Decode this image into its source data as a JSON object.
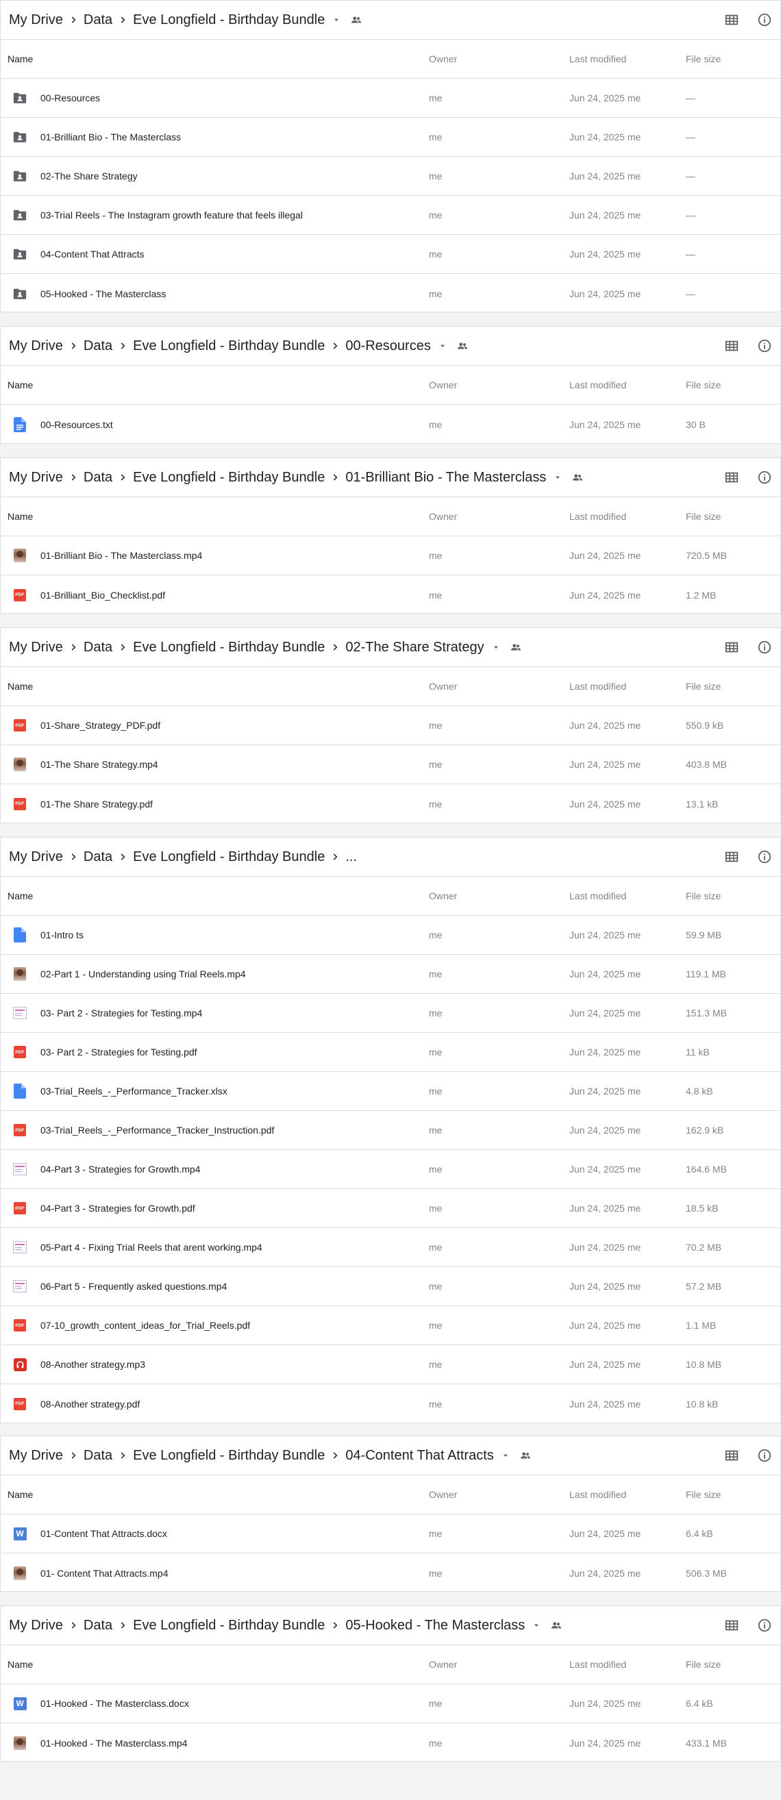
{
  "columns": {
    "name": "Name",
    "owner": "Owner",
    "modified": "Last modified",
    "size": "File size"
  },
  "panels": [
    {
      "crumbs": [
        "My Drive",
        "Data",
        "Eve Longfield - Birthday Bundle"
      ],
      "caret": true,
      "shared": true,
      "rows": [
        {
          "icon": "folder-shared",
          "name": "00-Resources",
          "owner": "me",
          "modified": "Jun 24, 2025 me",
          "size": "—"
        },
        {
          "icon": "folder-shared",
          "name": "01-Brilliant Bio - The Masterclass",
          "owner": "me",
          "modified": "Jun 24, 2025 me",
          "size": "—"
        },
        {
          "icon": "folder-shared",
          "name": "02-The Share Strategy",
          "owner": "me",
          "modified": "Jun 24, 2025 me",
          "size": "—"
        },
        {
          "icon": "folder-shared",
          "name": "03-Trial Reels - The Instagram growth feature that feels illegal",
          "owner": "me",
          "modified": "Jun 24, 2025 me",
          "size": "—"
        },
        {
          "icon": "folder-shared",
          "name": "04-Content That Attracts",
          "owner": "me",
          "modified": "Jun 24, 2025 me",
          "size": "—"
        },
        {
          "icon": "folder-shared",
          "name": "05-Hooked - The Masterclass",
          "owner": "me",
          "modified": "Jun 24, 2025 me",
          "size": "—"
        }
      ]
    },
    {
      "crumbs": [
        "My Drive",
        "Data",
        "Eve Longfield - Birthday Bundle",
        "00-Resources"
      ],
      "caret": true,
      "shared": true,
      "rows": [
        {
          "icon": "doc",
          "name": "00-Resources.txt",
          "owner": "me",
          "modified": "Jun 24, 2025 me",
          "size": "30 B"
        }
      ]
    },
    {
      "crumbs": [
        "My Drive",
        "Data",
        "Eve Longfield - Birthday Bundle",
        "01-Brilliant Bio - The Masterclass"
      ],
      "caret": true,
      "shared": true,
      "rows": [
        {
          "icon": "video-thumb",
          "name": "01-Brilliant Bio - The Masterclass.mp4",
          "owner": "me",
          "modified": "Jun 24, 2025 me",
          "size": "720.5 MB"
        },
        {
          "icon": "pdf",
          "name": "01-Brilliant_Bio_Checklist.pdf",
          "owner": "me",
          "modified": "Jun 24, 2025 me",
          "size": "1.2 MB"
        }
      ]
    },
    {
      "crumbs": [
        "My Drive",
        "Data",
        "Eve Longfield - Birthday Bundle",
        "02-The Share Strategy"
      ],
      "caret": true,
      "shared": true,
      "rows": [
        {
          "icon": "pdf",
          "name": "01-Share_Strategy_PDF.pdf",
          "owner": "me",
          "modified": "Jun 24, 2025 me",
          "size": "550.9 kB"
        },
        {
          "icon": "video-thumb",
          "name": "01-The Share Strategy.mp4",
          "owner": "me",
          "modified": "Jun 24, 2025 me",
          "size": "403.8 MB"
        },
        {
          "icon": "pdf",
          "name": "01-The Share Strategy.pdf",
          "owner": "me",
          "modified": "Jun 24, 2025 me",
          "size": "13.1 kB"
        }
      ]
    },
    {
      "crumbs": [
        "My Drive",
        "Data",
        "Eve Longfield - Birthday Bundle",
        "..."
      ],
      "caret": false,
      "shared": false,
      "rows": [
        {
          "icon": "doc-blank",
          "name": "01-Intro ts",
          "owner": "me",
          "modified": "Jun 24, 2025 me",
          "size": "59.9 MB"
        },
        {
          "icon": "video-thumb",
          "name": "02-Part 1 - Understanding using Trial Reels.mp4",
          "owner": "me",
          "modified": "Jun 24, 2025 me",
          "size": "119.1 MB"
        },
        {
          "icon": "slide-thumb",
          "name": "03- Part 2 - Strategies for Testing.mp4",
          "owner": "me",
          "modified": "Jun 24, 2025 me",
          "size": "151.3 MB"
        },
        {
          "icon": "pdf",
          "name": "03- Part 2 - Strategies for Testing.pdf",
          "owner": "me",
          "modified": "Jun 24, 2025 me",
          "size": "11 kB"
        },
        {
          "icon": "doc-blank",
          "name": "03-Trial_Reels_-_Performance_Tracker.xlsx",
          "owner": "me",
          "modified": "Jun 24, 2025 me",
          "size": "4.8 kB"
        },
        {
          "icon": "pdf",
          "name": "03-Trial_Reels_-_Performance_Tracker_Instruction.pdf",
          "owner": "me",
          "modified": "Jun 24, 2025 me",
          "size": "162.9 kB"
        },
        {
          "icon": "slide-thumb",
          "name": "04-Part 3 - Strategies for Growth.mp4",
          "owner": "me",
          "modified": "Jun 24, 2025 me",
          "size": "164.6 MB"
        },
        {
          "icon": "pdf",
          "name": "04-Part 3 - Strategies for Growth.pdf",
          "owner": "me",
          "modified": "Jun 24, 2025 me",
          "size": "18.5 kB"
        },
        {
          "icon": "slide-thumb",
          "name": "05-Part 4 - Fixing Trial Reels that arent working.mp4",
          "owner": "me",
          "modified": "Jun 24, 2025 me",
          "size": "70.2 MB"
        },
        {
          "icon": "slide-thumb",
          "name": "06-Part 5 - Frequently asked questions.mp4",
          "owner": "me",
          "modified": "Jun 24, 2025 me",
          "size": "57.2 MB"
        },
        {
          "icon": "pdf",
          "name": "07-10_growth_content_ideas_for_Trial_Reels.pdf",
          "owner": "me",
          "modified": "Jun 24, 2025 me",
          "size": "1.1 MB"
        },
        {
          "icon": "audio",
          "name": "08-Another strategy.mp3",
          "owner": "me",
          "modified": "Jun 24, 2025 me",
          "size": "10.8 MB"
        },
        {
          "icon": "pdf",
          "name": "08-Another strategy.pdf",
          "owner": "me",
          "modified": "Jun 24, 2025 me",
          "size": "10.8 kB"
        }
      ]
    },
    {
      "crumbs": [
        "My Drive",
        "Data",
        "Eve Longfield - Birthday Bundle",
        "04-Content That Attracts"
      ],
      "caret": true,
      "shared": true,
      "rows": [
        {
          "icon": "word",
          "name": "01-Content That Attracts.docx",
          "owner": "me",
          "modified": "Jun 24, 2025 me",
          "size": "6.4 kB"
        },
        {
          "icon": "video-thumb",
          "name": "01- Content That Attracts.mp4",
          "owner": "me",
          "modified": "Jun 24, 2025 me",
          "size": "506.3 MB"
        }
      ]
    },
    {
      "crumbs": [
        "My Drive",
        "Data",
        "Eve Longfield - Birthday Bundle",
        "05-Hooked - The Masterclass"
      ],
      "caret": true,
      "shared": true,
      "rows": [
        {
          "icon": "word",
          "name": "01-Hooked - The Masterclass.docx",
          "owner": "me",
          "modified": "Jun 24, 2025 me",
          "size": "6.4 kB"
        },
        {
          "icon": "video-thumb",
          "name": "01-Hooked - The Masterclass.mp4",
          "owner": "me",
          "modified": "Jun 24, 2025 me",
          "size": "433.1 MB"
        }
      ]
    }
  ]
}
